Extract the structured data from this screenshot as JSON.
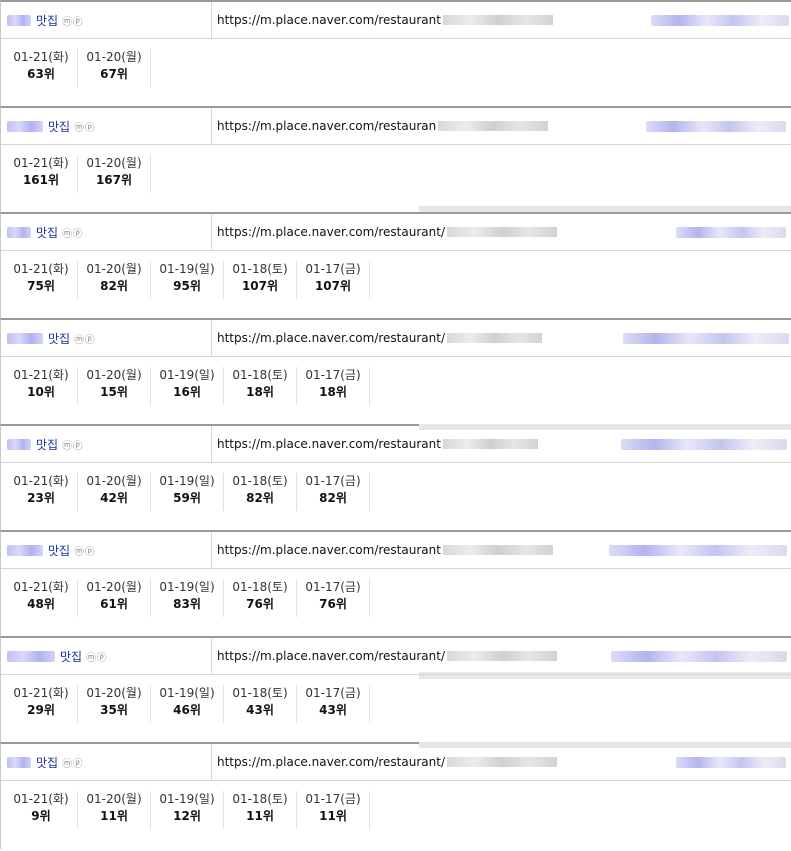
{
  "entries": [
    {
      "keyword": "맛집",
      "suffix": "ⓜⓟ",
      "url": "https://m.place.naver.com/restaurant",
      "ranks": [
        {
          "date": "01-21(화)",
          "rank": "63위"
        },
        {
          "date": "01-20(월)",
          "rank": "67위"
        }
      ]
    },
    {
      "keyword": "맛집",
      "suffix": "ⓜⓟ",
      "url": "https://m.place.naver.com/restauran",
      "ranks": [
        {
          "date": "01-21(화)",
          "rank": "161위"
        },
        {
          "date": "01-20(월)",
          "rank": "167위"
        }
      ]
    },
    {
      "keyword": "맛집",
      "suffix": "ⓜⓟ",
      "url": "https://m.place.naver.com/restaurant/",
      "ranks": [
        {
          "date": "01-21(화)",
          "rank": "75위"
        },
        {
          "date": "01-20(월)",
          "rank": "82위"
        },
        {
          "date": "01-19(일)",
          "rank": "95위"
        },
        {
          "date": "01-18(토)",
          "rank": "107위"
        },
        {
          "date": "01-17(금)",
          "rank": "107위"
        }
      ]
    },
    {
      "keyword": "맛집",
      "suffix": "ⓜⓟ",
      "url": "https://m.place.naver.com/restaurant/",
      "ranks": [
        {
          "date": "01-21(화)",
          "rank": "10위"
        },
        {
          "date": "01-20(월)",
          "rank": "15위"
        },
        {
          "date": "01-19(일)",
          "rank": "16위"
        },
        {
          "date": "01-18(토)",
          "rank": "18위"
        },
        {
          "date": "01-17(금)",
          "rank": "18위"
        }
      ]
    },
    {
      "keyword": "맛집",
      "suffix": "ⓜⓟ",
      "url": "https://m.place.naver.com/restaurant",
      "ranks": [
        {
          "date": "01-21(화)",
          "rank": "23위"
        },
        {
          "date": "01-20(월)",
          "rank": "42위"
        },
        {
          "date": "01-19(일)",
          "rank": "59위"
        },
        {
          "date": "01-18(토)",
          "rank": "82위"
        },
        {
          "date": "01-17(금)",
          "rank": "82위"
        }
      ]
    },
    {
      "keyword": "맛집",
      "suffix": "ⓜⓟ",
      "url": "https://m.place.naver.com/restaurant",
      "ranks": [
        {
          "date": "01-21(화)",
          "rank": "48위"
        },
        {
          "date": "01-20(월)",
          "rank": "61위"
        },
        {
          "date": "01-19(일)",
          "rank": "83위"
        },
        {
          "date": "01-18(토)",
          "rank": "76위"
        },
        {
          "date": "01-17(금)",
          "rank": "76위"
        }
      ]
    },
    {
      "keyword": "맛집",
      "suffix": "ⓜⓟ",
      "url": "https://m.place.naver.com/restaurant/",
      "ranks": [
        {
          "date": "01-21(화)",
          "rank": "29위"
        },
        {
          "date": "01-20(월)",
          "rank": "35위"
        },
        {
          "date": "01-19(일)",
          "rank": "46위"
        },
        {
          "date": "01-18(토)",
          "rank": "43위"
        },
        {
          "date": "01-17(금)",
          "rank": "43위"
        }
      ]
    },
    {
      "keyword": "맛집",
      "suffix": "ⓜⓟ",
      "url": "https://m.place.naver.com/restaurant/",
      "ranks": [
        {
          "date": "01-21(화)",
          "rank": "9위"
        },
        {
          "date": "01-20(월)",
          "rank": "11위"
        },
        {
          "date": "01-19(일)",
          "rank": "12위"
        },
        {
          "date": "01-18(토)",
          "rank": "11위"
        },
        {
          "date": "01-17(금)",
          "rank": "11위"
        }
      ]
    }
  ]
}
